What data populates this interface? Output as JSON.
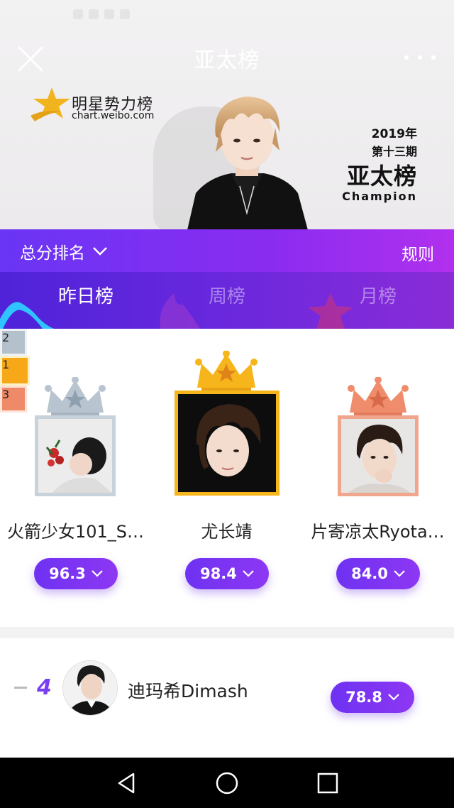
{
  "header": {
    "title": "亚太榜",
    "logo_name": "明星势力榜",
    "logo_url": "chart.weibo.com",
    "issue_year": "2019年",
    "issue_number": "第十三期",
    "issue_chart": "亚太榜",
    "issue_label": "Champion"
  },
  "filter": {
    "sort_label": "总分排名",
    "rules_label": "规则"
  },
  "tabs": [
    {
      "label": "昨日榜",
      "active": true
    },
    {
      "label": "周榜",
      "active": false
    },
    {
      "label": "月榜",
      "active": false
    }
  ],
  "podium": {
    "first": {
      "rank": "1",
      "name": "尤长靖",
      "score": "98.4"
    },
    "second": {
      "rank": "2",
      "name": "火箭少女101_S…",
      "score": "96.3"
    },
    "third": {
      "rank": "3",
      "name": "片寄凉太Ryota…",
      "score": "84.0"
    }
  },
  "list": [
    {
      "rank": "4",
      "trend": "-",
      "name": "迪玛希Dimash",
      "score": "78.8"
    }
  ],
  "colors": {
    "accent_purple": "#7b3df2",
    "gold": "#f7b51c",
    "silver": "#b8c4cf",
    "bronze": "#ef8c6c"
  },
  "icons": {
    "close": "close-icon",
    "more": "more-dots-icon",
    "dropdown": "chevron-down-icon",
    "back": "back-triangle-icon",
    "home": "home-circle-icon",
    "recents": "recents-square-icon"
  }
}
